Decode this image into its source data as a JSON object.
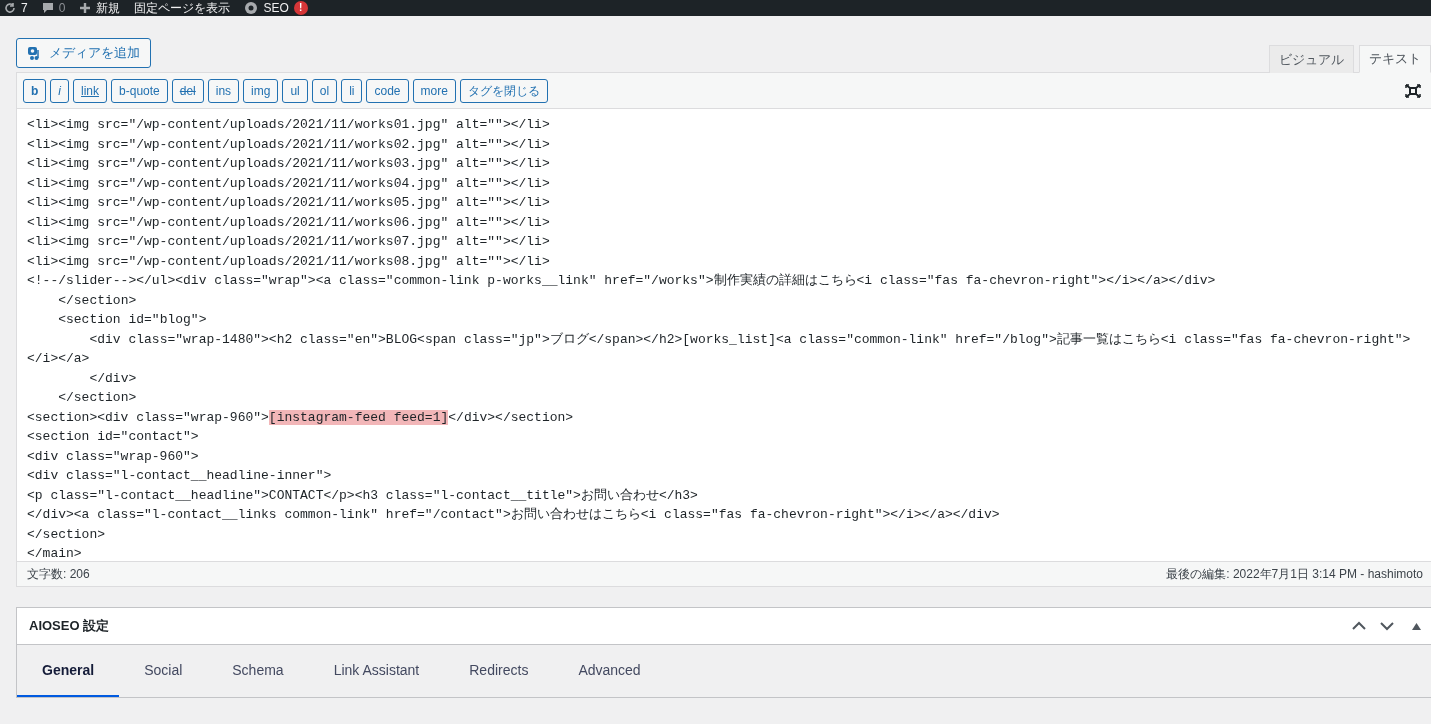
{
  "admin_bar": {
    "updates": "7",
    "comments": "0",
    "new": "新規",
    "view_page": "固定ページを表示",
    "seo": "SEO",
    "seo_badge": "!"
  },
  "add_media": "メディアを追加",
  "editor_tabs": [
    {
      "label": "ビジュアル",
      "selected": false
    },
    {
      "label": "テキスト",
      "selected": true
    }
  ],
  "quicktags": [
    {
      "label": "b",
      "kind": "bold"
    },
    {
      "label": "i",
      "kind": "italic"
    },
    {
      "label": "link",
      "kind": "link"
    },
    {
      "label": "b-quote",
      "kind": "plain"
    },
    {
      "label": "del",
      "kind": "strike"
    },
    {
      "label": "ins",
      "kind": "plain"
    },
    {
      "label": "img",
      "kind": "plain"
    },
    {
      "label": "ul",
      "kind": "plain"
    },
    {
      "label": "ol",
      "kind": "plain"
    },
    {
      "label": "li",
      "kind": "plain"
    },
    {
      "label": "code",
      "kind": "plain"
    },
    {
      "label": "more",
      "kind": "plain"
    },
    {
      "label": "タグを閉じる",
      "kind": "plain"
    }
  ],
  "code_lines": [
    [
      {
        "text": "<li><img src=\"/wp-content/uploads/2021/11/works01.jpg\" alt=\"\"></li>",
        "highlight": false
      }
    ],
    [
      {
        "text": "<li><img src=\"/wp-content/uploads/2021/11/works02.jpg\" alt=\"\"></li>",
        "highlight": false
      }
    ],
    [
      {
        "text": "<li><img src=\"/wp-content/uploads/2021/11/works03.jpg\" alt=\"\"></li>",
        "highlight": false
      }
    ],
    [
      {
        "text": "<li><img src=\"/wp-content/uploads/2021/11/works04.jpg\" alt=\"\"></li>",
        "highlight": false
      }
    ],
    [
      {
        "text": "<li><img src=\"/wp-content/uploads/2021/11/works05.jpg\" alt=\"\"></li>",
        "highlight": false
      }
    ],
    [
      {
        "text": "<li><img src=\"/wp-content/uploads/2021/11/works06.jpg\" alt=\"\"></li>",
        "highlight": false
      }
    ],
    [
      {
        "text": "<li><img src=\"/wp-content/uploads/2021/11/works07.jpg\" alt=\"\"></li>",
        "highlight": false
      }
    ],
    [
      {
        "text": "<li><img src=\"/wp-content/uploads/2021/11/works08.jpg\" alt=\"\"></li>",
        "highlight": false
      }
    ],
    [
      {
        "text": "<!--/slider--></ul><div class=\"wrap\"><a class=\"common-link p-works__link\" href=\"/works\">制作実績の詳細はこちら<i class=\"fas fa-chevron-right\"></i></a></div>",
        "highlight": false
      }
    ],
    [
      {
        "text": "    </section>",
        "highlight": false
      }
    ],
    [
      {
        "text": "    <section id=\"blog\">",
        "highlight": false
      }
    ],
    [
      {
        "text": "        <div class=\"wrap-1480\"><h2 class=\"en\">BLOG<span class=\"jp\">ブログ</span></h2>[works_list]<a class=\"common-link\" href=\"/blog\">記事一覧はこちら<i class=\"fas fa-chevron-right\"></i></a>",
        "highlight": false
      }
    ],
    [
      {
        "text": "        </div>",
        "highlight": false
      }
    ],
    [
      {
        "text": "    </section>",
        "highlight": false
      }
    ],
    [
      {
        "text": "<section><div class=\"wrap-960\">",
        "highlight": false
      },
      {
        "text": "[instagram-feed feed=1]",
        "highlight": true
      },
      {
        "text": "</div></section>",
        "highlight": false
      }
    ],
    [
      {
        "text": "<section id=\"contact\">",
        "highlight": false
      }
    ],
    [
      {
        "text": "<div class=\"wrap-960\">",
        "highlight": false
      }
    ],
    [
      {
        "text": "<div class=\"l-contact__headline-inner\">",
        "highlight": false
      }
    ],
    [
      {
        "text": "<p class=\"l-contact__headline\">CONTACT</p><h3 class=\"l-contact__title\">お問い合わせ</h3>",
        "highlight": false
      }
    ],
    [
      {
        "text": "</div><a class=\"l-contact__links common-link\" href=\"/contact\">お問い合わせはこちら<i class=\"fas fa-chevron-right\"></i></a></div>",
        "highlight": false
      }
    ],
    [
      {
        "text": "</section>",
        "highlight": false
      }
    ],
    [
      {
        "text": "</main>",
        "highlight": false
      }
    ]
  ],
  "status_bar": {
    "word_count": "文字数: 206",
    "last_edit": "最後の編集: 2022年7月1日 3:14 PM - hashimoto"
  },
  "seo_panel": {
    "title": "AIOSEO 設定",
    "tabs": [
      {
        "label": "General",
        "selected": true
      },
      {
        "label": "Social",
        "selected": false
      },
      {
        "label": "Schema",
        "selected": false
      },
      {
        "label": "Link Assistant",
        "selected": false
      },
      {
        "label": "Redirects",
        "selected": false
      },
      {
        "label": "Advanced",
        "selected": false
      }
    ]
  }
}
